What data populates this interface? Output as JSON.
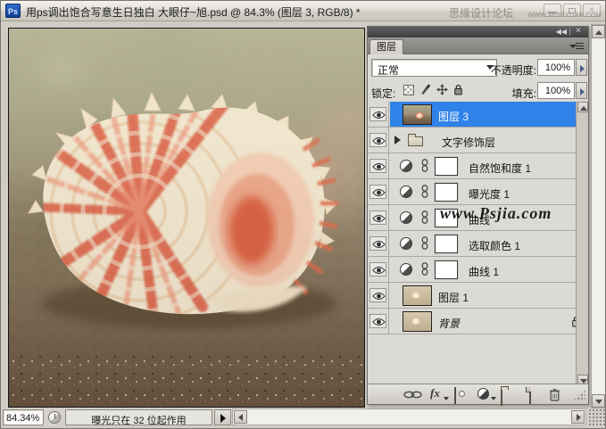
{
  "window": {
    "app_badge": "Ps",
    "title": "用ps调出饱合写意生日独白 大眼仔~旭.psd @ 84.3% (图层 3, RGB/8) *",
    "controls": {
      "close": "×"
    },
    "watermarks": {
      "forum": "思缘设计论坛",
      "site": "WWW.MISSYUAN.COM",
      "photo_site": "www.Psjia.com"
    }
  },
  "panel": {
    "collapse_icon": "◀◀",
    "close_icon": "×",
    "tab_label": "图层",
    "blend_mode": "正常",
    "opacity": {
      "label": "不透明度:",
      "value": "100%"
    },
    "lock": {
      "label": "锁定:"
    },
    "fill": {
      "label": "填充:",
      "value": "100%"
    },
    "fx_label": "fx",
    "layers": [
      {
        "name": "图层 3",
        "type": "image",
        "selected": true
      },
      {
        "name": "文字修饰层",
        "type": "group",
        "selected": false
      },
      {
        "name": "自然饱和度 1",
        "type": "adjustment",
        "selected": false
      },
      {
        "name": "曝光度 1",
        "type": "adjustment",
        "selected": false
      },
      {
        "name": "曲线",
        "type": "adjustment",
        "selected": false
      },
      {
        "name": "选取颜色 1",
        "type": "adjustment",
        "selected": false
      },
      {
        "name": "曲线 1",
        "type": "adjustment",
        "selected": false
      },
      {
        "name": "图层 1",
        "type": "image",
        "selected": false
      },
      {
        "name": "背景",
        "type": "background",
        "locked": true,
        "selected": false
      }
    ]
  },
  "status": {
    "zoom": "84.34%",
    "message": "曝光只在 32 位起作用"
  },
  "colors": {
    "selection_blue": "#2f82e8",
    "panel_gray": "#dcdad5",
    "shell_cream": "#f6ecd6",
    "shell_red": "#dc5036"
  }
}
